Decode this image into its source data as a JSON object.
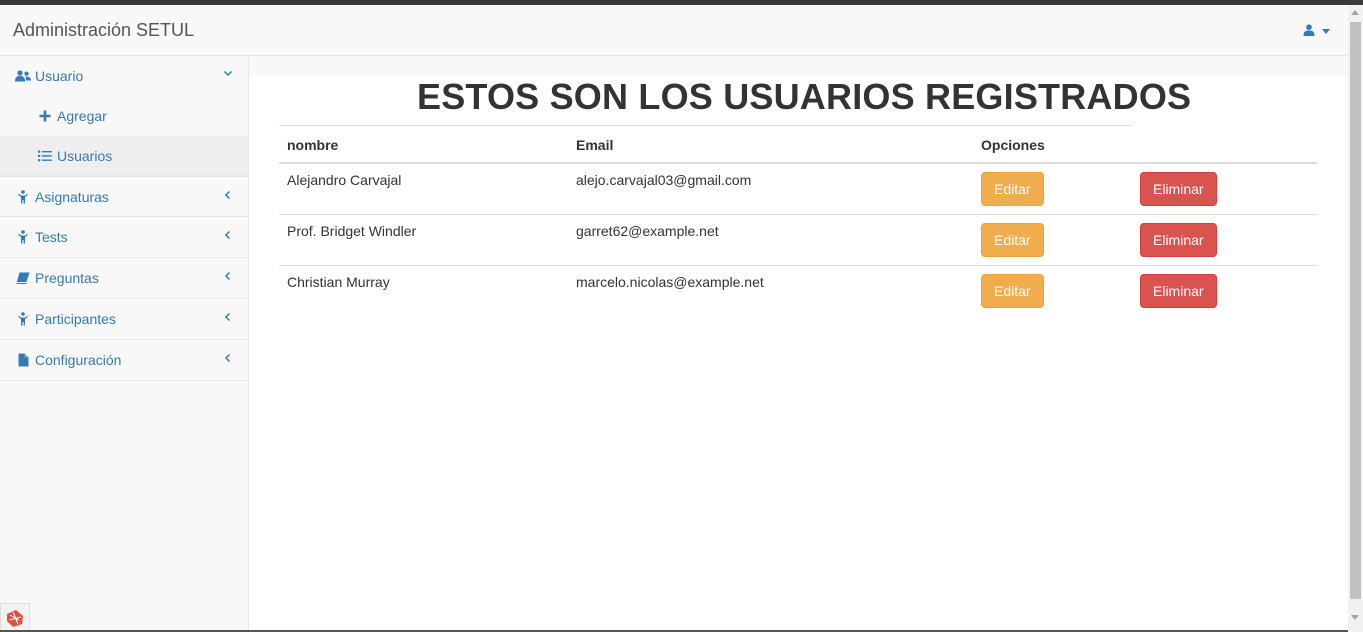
{
  "navbar": {
    "brand": "Administración SETUL",
    "user_icon": "user-icon"
  },
  "sidebar": {
    "items": [
      {
        "label": "Usuario",
        "icon": "users-icon",
        "expanded": true
      },
      {
        "label": "Agregar",
        "icon": "plus-icon"
      },
      {
        "label": "Usuarios",
        "icon": "list-icon",
        "active": true
      },
      {
        "label": "Asignaturas",
        "icon": "child-icon"
      },
      {
        "label": "Tests",
        "icon": "child-icon"
      },
      {
        "label": "Preguntas",
        "icon": "book-icon"
      },
      {
        "label": "Participantes",
        "icon": "child-icon"
      },
      {
        "label": "Configuración",
        "icon": "file-icon"
      }
    ]
  },
  "main": {
    "title": "ESTOS SON LOS USUARIOS REGISTRADOS",
    "table": {
      "headers": [
        "nombre",
        "Email",
        "Opciones"
      ],
      "rows": [
        {
          "name": "Alejandro Carvajal",
          "email": "alejo.carvajal03@gmail.com"
        },
        {
          "name": "Prof. Bridget Windler",
          "email": "garret62@example.net"
        },
        {
          "name": "Christian Murray",
          "email": "marcelo.nicolas@example.net"
        }
      ],
      "edit_label": "Editar",
      "delete_label": "Eliminar"
    }
  },
  "colors": {
    "link": "#337ab7",
    "warning": "#f0ad4e",
    "danger": "#d9534f"
  }
}
